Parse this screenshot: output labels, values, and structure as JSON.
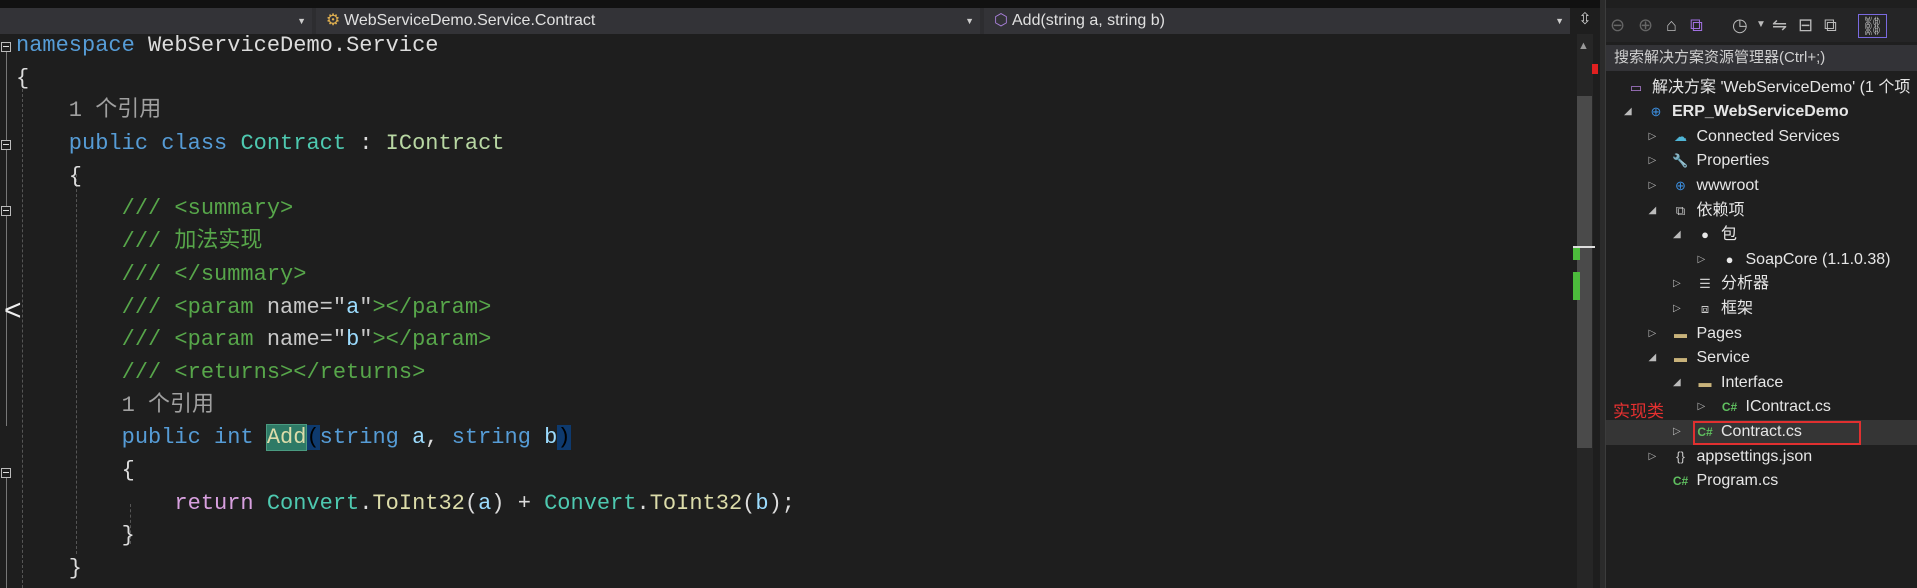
{
  "navbar": {
    "project_dropdown": "",
    "class_dropdown": "WebServiceDemo.Service.Contract",
    "member_dropdown": "Add(string a, string b)"
  },
  "code_lines": [
    [
      [
        "kw",
        "namespace"
      ],
      [
        "tx",
        " WebServiceDemo.Service"
      ]
    ],
    [
      [
        "tx",
        "{"
      ]
    ],
    [
      [
        "cl",
        "    1 个引用"
      ]
    ],
    [
      [
        "kw",
        "    public class "
      ],
      [
        "ty",
        "Contract"
      ],
      [
        "tx",
        " : "
      ],
      [
        "if",
        "IContract"
      ]
    ],
    [
      [
        "tx",
        "    {"
      ]
    ],
    [
      [
        "cm",
        "        /// <summary>"
      ]
    ],
    [
      [
        "cm",
        "        /// 加法实现"
      ]
    ],
    [
      [
        "cm",
        "        /// </summary>"
      ]
    ],
    [
      [
        "cm",
        "        /// <param "
      ],
      [
        "cmx",
        "name=\""
      ],
      [
        "pm",
        "a"
      ],
      [
        "cmx",
        "\""
      ],
      [
        "cm",
        "></param>"
      ]
    ],
    [
      [
        "cm",
        "        /// <param "
      ],
      [
        "cmx",
        "name=\""
      ],
      [
        "pm",
        "b"
      ],
      [
        "cmx",
        "\""
      ],
      [
        "cm",
        "></param>"
      ]
    ],
    [
      [
        "cm",
        "        /// <returns></returns>"
      ]
    ],
    [
      [
        "cl",
        "        1 个引用"
      ]
    ],
    [
      [
        "kw",
        "        public int "
      ],
      [
        "hl",
        "Add"
      ],
      [
        "br",
        "("
      ],
      [
        "kw",
        "string"
      ],
      [
        "pm",
        " a"
      ],
      [
        "tx",
        ", "
      ],
      [
        "kw",
        "string"
      ],
      [
        "pm",
        " b"
      ],
      [
        "br",
        ")"
      ]
    ],
    [
      [
        "tx",
        "        {"
      ]
    ],
    [
      [
        "rt",
        "            return "
      ],
      [
        "ty",
        "Convert"
      ],
      [
        "tx",
        "."
      ],
      [
        "mt",
        "ToInt32"
      ],
      [
        "tx",
        "("
      ],
      [
        "pm",
        "a"
      ],
      [
        "tx",
        ") + "
      ],
      [
        "ty",
        "Convert"
      ],
      [
        "tx",
        "."
      ],
      [
        "mt",
        "ToInt32"
      ],
      [
        "tx",
        "("
      ],
      [
        "pm",
        "b"
      ],
      [
        "tx",
        ");"
      ]
    ],
    [
      [
        "tx",
        "        }"
      ]
    ],
    [
      [
        "tx",
        "    }"
      ]
    ]
  ],
  "explorer": {
    "search_placeholder": "搜索解决方案资源管理器(Ctrl+;)",
    "annotation": "实现类",
    "items": [
      {
        "label": "解决方案 'WebServiceDemo' (1 个项",
        "level": 0,
        "exp": "",
        "icon": "solution-icon",
        "glyph": "▭",
        "color": "#b180d7"
      },
      {
        "label": "ERP_WebServiceDemo",
        "level": 0,
        "exp": "◢",
        "icon": "web-project-icon",
        "glyph": "⊕",
        "color": "#3c8fe0",
        "bold": true
      },
      {
        "label": "Connected Services",
        "level": 1,
        "exp": "▷",
        "icon": "connected-services-icon",
        "glyph": "☁",
        "color": "#4fb5d6"
      },
      {
        "label": "Properties",
        "level": 1,
        "exp": "▷",
        "icon": "properties-icon",
        "glyph": "🔧",
        "color": "#c8b27a"
      },
      {
        "label": "wwwroot",
        "level": 1,
        "exp": "▷",
        "icon": "globe-icon",
        "glyph": "⊕",
        "color": "#3c8fe0"
      },
      {
        "label": "依赖项",
        "level": 1,
        "exp": "◢",
        "icon": "dependencies-icon",
        "glyph": "⧉",
        "color": "#cccccc"
      },
      {
        "label": "包",
        "level": 2,
        "exp": "◢",
        "icon": "package-icon",
        "glyph": "●",
        "color": "#e8e8e8"
      },
      {
        "label": "SoapCore (1.1.0.38)",
        "level": 3,
        "exp": "▷",
        "icon": "nuget-package-icon",
        "glyph": "●",
        "color": "#e8e8e8"
      },
      {
        "label": "分析器",
        "level": 2,
        "exp": "▷",
        "icon": "analyzer-icon",
        "glyph": "☰",
        "color": "#cccccc"
      },
      {
        "label": "框架",
        "level": 2,
        "exp": "▷",
        "icon": "framework-icon",
        "glyph": "⧈",
        "color": "#cccccc"
      },
      {
        "label": "Pages",
        "level": 1,
        "exp": "▷",
        "icon": "folder-icon",
        "glyph": "▬",
        "color": "#c8b27a"
      },
      {
        "label": "Service",
        "level": 1,
        "exp": "◢",
        "icon": "folder-icon",
        "glyph": "▬",
        "color": "#c8b27a"
      },
      {
        "label": "Interface",
        "level": 2,
        "exp": "◢",
        "icon": "folder-icon",
        "glyph": "▬",
        "color": "#c8b27a"
      },
      {
        "label": "IContract.cs",
        "level": 3,
        "exp": "▷",
        "icon": "csharp-file-icon",
        "glyph": "C#",
        "color": "#5fbf5f"
      },
      {
        "label": "Contract.cs",
        "level": 2,
        "exp": "▷",
        "icon": "csharp-file-icon",
        "glyph": "C#",
        "color": "#5fbf5f",
        "selected": true
      },
      {
        "label": "appsettings.json",
        "level": 1,
        "exp": "▷",
        "icon": "json-file-icon",
        "glyph": "{}",
        "color": "#cccccc"
      },
      {
        "label": "Program.cs",
        "level": 1,
        "exp": "",
        "icon": "csharp-file-icon",
        "glyph": "C#",
        "color": "#5fbf5f"
      }
    ]
  }
}
